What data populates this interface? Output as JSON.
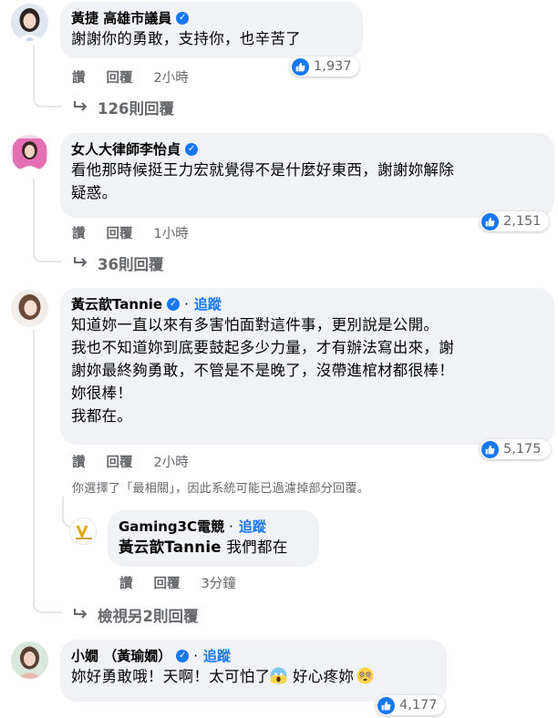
{
  "colors": {
    "accent": "#1877f2",
    "secondary_text": "#65676b",
    "bubble": "#f0f2f5"
  },
  "comments": [
    {
      "author": "黃捷 高雄市議員",
      "verified": true,
      "text": "謝謝你的勇敢，支持你，也辛苦了",
      "like_label": "讚",
      "reply_label": "回覆",
      "time": "2小時",
      "reaction_count": "1,937",
      "replies_label": "126則回覆"
    },
    {
      "author": "女人大律師李怡貞",
      "verified": true,
      "text": "看他那時候挺王力宏就覺得不是什麼好東西，謝謝妳解除\n疑惑。",
      "like_label": "讚",
      "reply_label": "回覆",
      "time": "1小時",
      "reaction_count": "2,151",
      "replies_label": "36則回覆"
    },
    {
      "author": "黃云歆Tannie",
      "verified": true,
      "follow_label": "追蹤",
      "text": "知道妳一直以來有多害怕面對這件事，更別說是公開。\n我也不知道妳到底要鼓起多少力量，才有辦法寫出來，謝\n謝妳最終夠勇敢，不管是不是晚了，沒帶進棺材都很棒！\n妳很棒！\n我都在。",
      "like_label": "讚",
      "reply_label": "回覆",
      "time": "2小時",
      "reaction_count": "5,175",
      "filter_note": "你選擇了「最相關」，因此系統可能已過濾掉部分回覆。",
      "reply": {
        "author": "Gaming3C電競",
        "follow_label": "追蹤",
        "mention": "黃云歆Tannie",
        "text": " 我們都在",
        "like_label": "讚",
        "reply_label": "回覆",
        "time": "3分鐘"
      },
      "more_replies_label": "檢視另2則回覆"
    },
    {
      "author": "小嫺 （黃瑜嫺）",
      "verified": true,
      "follow_label": "追蹤",
      "text_a": "妳好勇敢哦！天啊！太可怕了",
      "text_b": " 好心疼妳",
      "emoji_a": "screaming-face-emoji",
      "emoji_b": "flushed-face-emoji",
      "reaction_count": "4,177"
    }
  ]
}
